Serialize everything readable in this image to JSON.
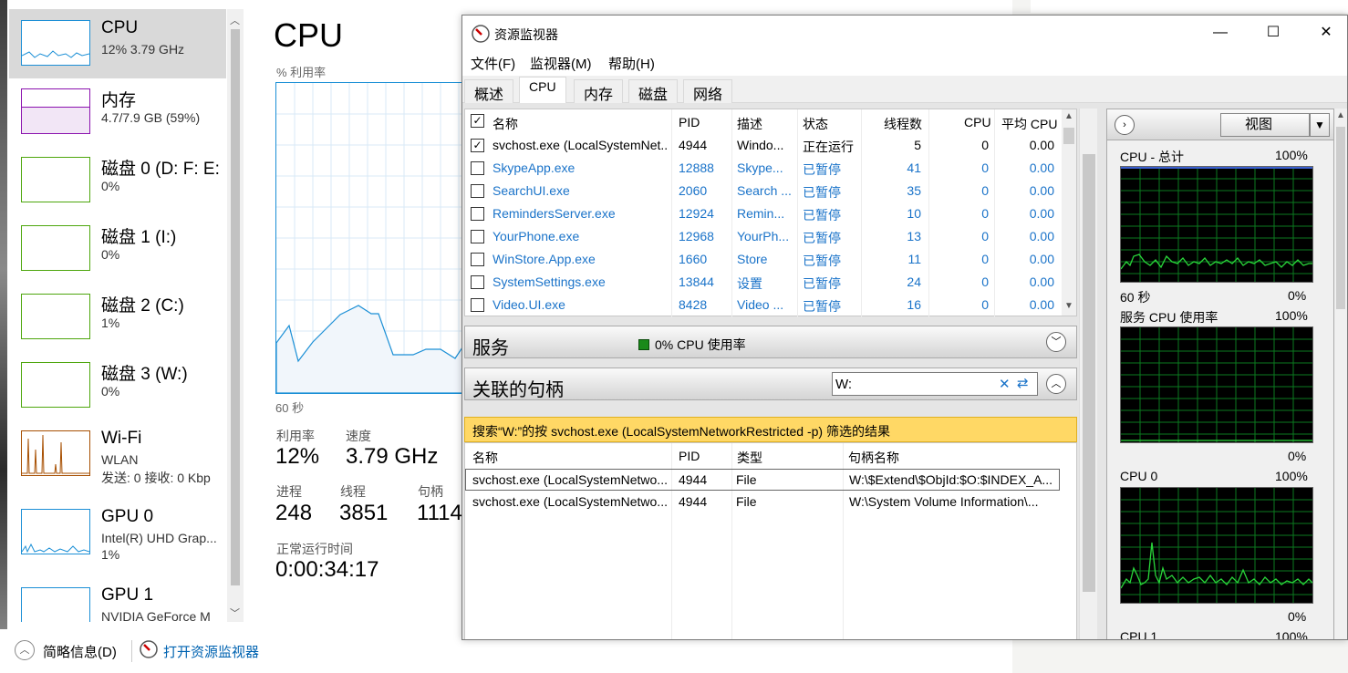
{
  "task_manager": {
    "items": [
      {
        "title": "CPU",
        "sub": "12% 3.79 GHz",
        "sub2": "",
        "color": "#1b8fd6"
      },
      {
        "title": "内存",
        "sub": "4.7/7.9 GB (59%)",
        "sub2": "",
        "color": "#8b12ae"
      },
      {
        "title": "磁盘 0 (D: F: E:",
        "sub": "0%",
        "sub2": "",
        "color": "#4da60c"
      },
      {
        "title": "磁盘 1 (I:)",
        "sub": "0%",
        "sub2": "",
        "color": "#4da60c"
      },
      {
        "title": "磁盘 2 (C:)",
        "sub": "1%",
        "sub2": "",
        "color": "#4da60c"
      },
      {
        "title": "磁盘 3 (W:)",
        "sub": "0%",
        "sub2": "",
        "color": "#4da60c"
      },
      {
        "title": "Wi-Fi",
        "sub": "WLAN",
        "sub2": "发送: 0 接收: 0 Kbp",
        "color": "#a74f01"
      },
      {
        "title": "GPU 0",
        "sub": "Intel(R) UHD Grap...",
        "sub2": "1%",
        "color": "#1b8fd6"
      },
      {
        "title": "GPU 1",
        "sub": "NVIDIA GeForce M",
        "sub2": "",
        "color": "#1b8fd6"
      }
    ],
    "main_title": "CPU",
    "util_label": "% 利用率",
    "graph_time": "60 秒",
    "stats": {
      "util_label": "利用率",
      "util_value": "12%",
      "speed_label": "速度",
      "speed_value": "3.79 GHz",
      "proc_label": "进程",
      "proc_value": "248",
      "thread_label": "线程",
      "thread_value": "3851",
      "handle_label": "句柄",
      "handle_value": "1114",
      "uptime_label": "正常运行时间",
      "uptime_value": "0:00:34:17"
    },
    "footer": {
      "brief": "简略信息(D)",
      "open_resmon": "打开资源监视器"
    }
  },
  "resource_monitor": {
    "title": "资源监视器",
    "window_buttons": {
      "minimize": "—",
      "maximize": "☐",
      "close": "✕"
    },
    "menu": [
      "文件(F)",
      "监视器(M)",
      "帮助(H)"
    ],
    "tabs": [
      "概述",
      "CPU",
      "内存",
      "磁盘",
      "网络"
    ],
    "active_tab": "CPU",
    "process_columns": [
      "名称",
      "PID",
      "描述",
      "状态",
      "线程数",
      "CPU",
      "平均 CPU"
    ],
    "processes": [
      {
        "name": "svchost.exe (LocalSystemNet...",
        "pid": "4944",
        "desc": "Windo...",
        "status": "正在运行",
        "threads": "5",
        "cpu": "0",
        "avg": "0.00",
        "checked": true,
        "suspended": false
      },
      {
        "name": "SkypeApp.exe",
        "pid": "12888",
        "desc": "Skype...",
        "status": "已暂停",
        "threads": "41",
        "cpu": "0",
        "avg": "0.00",
        "checked": false,
        "suspended": true
      },
      {
        "name": "SearchUI.exe",
        "pid": "2060",
        "desc": "Search ...",
        "status": "已暂停",
        "threads": "35",
        "cpu": "0",
        "avg": "0.00",
        "checked": false,
        "suspended": true
      },
      {
        "name": "RemindersServer.exe",
        "pid": "12924",
        "desc": "Remin...",
        "status": "已暂停",
        "threads": "10",
        "cpu": "0",
        "avg": "0.00",
        "checked": false,
        "suspended": true
      },
      {
        "name": "YourPhone.exe",
        "pid": "12968",
        "desc": "YourPh...",
        "status": "已暂停",
        "threads": "13",
        "cpu": "0",
        "avg": "0.00",
        "checked": false,
        "suspended": true
      },
      {
        "name": "WinStore.App.exe",
        "pid": "1660",
        "desc": "Store",
        "status": "已暂停",
        "threads": "11",
        "cpu": "0",
        "avg": "0.00",
        "checked": false,
        "suspended": true
      },
      {
        "name": "SystemSettings.exe",
        "pid": "13844",
        "desc": "设置",
        "status": "已暂停",
        "threads": "24",
        "cpu": "0",
        "avg": "0.00",
        "checked": false,
        "suspended": true
      },
      {
        "name": "Video.UI.exe",
        "pid": "8428",
        "desc": "Video ...",
        "status": "已暂停",
        "threads": "16",
        "cpu": "0",
        "avg": "0.00",
        "checked": false,
        "suspended": true
      }
    ],
    "services": {
      "title": "服务",
      "status": "0% CPU 使用率"
    },
    "handles": {
      "title": "关联的句柄",
      "search_value": "W:",
      "filter_banner": "搜索“W:”的按 svchost.exe (LocalSystemNetworkRestricted -p) 筛选的结果",
      "columns": [
        "名称",
        "PID",
        "类型",
        "句柄名称"
      ],
      "rows": [
        {
          "name": "svchost.exe (LocalSystemNetwo...",
          "pid": "4944",
          "type": "File",
          "handle": "W:\\$Extend\\$ObjId:$O:$INDEX_A..."
        },
        {
          "name": "svchost.exe (LocalSystemNetwo...",
          "pid": "4944",
          "type": "File",
          "handle": "W:\\System Volume Information\\..."
        }
      ]
    },
    "graphs": {
      "view_label": "视图",
      "panels": [
        {
          "title": "CPU - 总计",
          "max": "100%",
          "time": "60 秒",
          "min": "0%"
        },
        {
          "title": "服务 CPU 使用率",
          "max": "100%",
          "time": "",
          "min": "0%"
        },
        {
          "title": "CPU 0",
          "max": "100%",
          "time": "",
          "min": "0%"
        },
        {
          "title": "CPU 1",
          "max": "100%",
          "time": "",
          "min": ""
        }
      ]
    }
  }
}
